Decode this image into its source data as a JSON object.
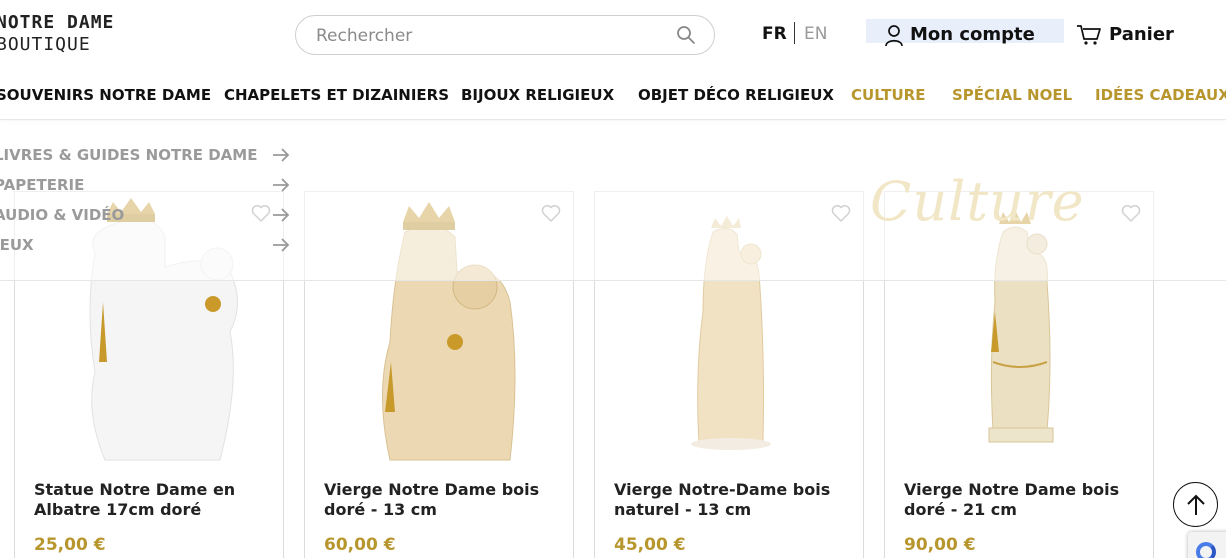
{
  "header": {
    "logo_line1": "NOTRE DAME",
    "logo_line2": "BOUTIQUE",
    "search_placeholder": "Rechercher",
    "lang_fr": "FR",
    "lang_en": "EN",
    "account_label": "Mon compte",
    "cart_label": "Panier"
  },
  "nav": {
    "items": [
      {
        "label": "SOUVENIRS NOTRE DAME"
      },
      {
        "label": "CHAPELETS ET DIZAINIERS"
      },
      {
        "label": "BIJOUX RELIGIEUX"
      },
      {
        "label": "OBJET DÉCO RELIGIEUX"
      },
      {
        "label": "CULTURE"
      },
      {
        "label": "SPÉCIAL NOEL"
      },
      {
        "label": "IDÉES CADEAUX"
      }
    ],
    "accent_color": "#b8962e"
  },
  "submenu": {
    "items": [
      {
        "label": "LIVRES & GUIDES NOTRE DAME"
      },
      {
        "label": "PAPETERIE"
      },
      {
        "label": "AUDIO & VIDÉO"
      },
      {
        "label": "JEUX"
      }
    ],
    "watermark": "Culture"
  },
  "products": [
    {
      "title": "Statue Notre Dame en Albatre 17cm doré",
      "price": "25,00 €",
      "image": "white-alabaster-virgin-statue"
    },
    {
      "title": "Vierge Notre Dame bois doré - 13 cm",
      "price": "60,00 €",
      "image": "gilded-wood-virgin-statue"
    },
    {
      "title": "Vierge Notre-Dame bois naturel - 13 cm",
      "price": "45,00 €",
      "image": "natural-wood-virgin-statue"
    },
    {
      "title": "Vierge Notre Dame bois doré - 21 cm",
      "price": "90,00 €",
      "image": "gilded-wood-virgin-statue-tall"
    }
  ]
}
